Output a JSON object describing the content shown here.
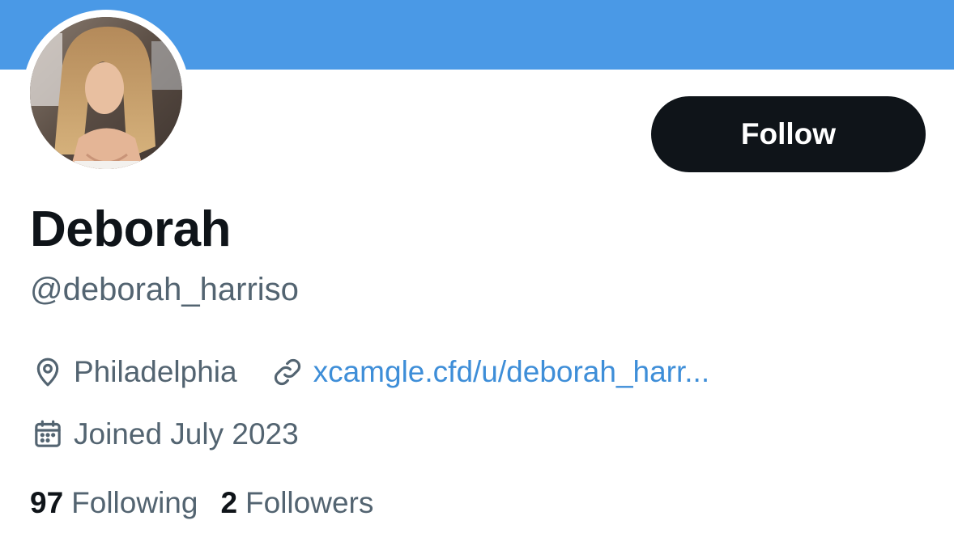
{
  "profile": {
    "display_name": "Deborah",
    "handle": "@deborah_harriso",
    "location": "Philadelphia",
    "website": "xcamgle.cfd/u/deborah_harr...",
    "joined": "Joined July 2023"
  },
  "actions": {
    "follow_label": "Follow"
  },
  "stats": {
    "following_count": "97",
    "following_label": "Following",
    "followers_count": "2",
    "followers_label": "Followers"
  },
  "icons": {
    "location": "map-pin-icon",
    "website": "link-icon",
    "joined": "calendar-icon"
  },
  "colors": {
    "banner": "#4a99e6",
    "follow_button_bg": "#0f1419",
    "link": "#3e8ed8",
    "secondary_text": "#536471",
    "primary_text": "#0f1419"
  }
}
